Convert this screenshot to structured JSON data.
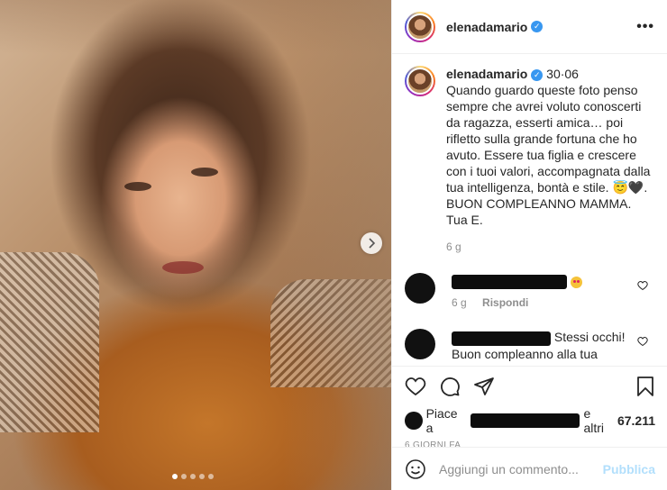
{
  "post": {
    "username": "elenadamario",
    "caption": {
      "username": "elenadamario",
      "date": "30·06",
      "text": "Quando guardo queste foto penso sempre che avrei voluto conoscerti da ragazza, esserti amica… poi rifletto sulla grande fortuna che ho avuto. Essere tua figlia e crescere con i tuoi valori, accompagnata dalla tua intelligenza, bontà e stile. 😇🖤.\nBUON COMPLEANNO MAMMA.\nTua E.",
      "age": "6 g"
    },
    "comments": [
      {
        "text": "",
        "age": "6 g",
        "reply_label": "Rispondi"
      },
      {
        "text": "Stessi occhi!\nBuon compleanno alla tua mamma"
      }
    ],
    "likes": {
      "prefix": "Piace a",
      "suffix": "e altri",
      "count": "67.211"
    },
    "date_label": "6 GIORNI FA",
    "add_comment": {
      "placeholder": "Aggiungi un commento...",
      "publish": "Pubblica"
    },
    "carousel": {
      "count": 5,
      "active": 1
    }
  },
  "colors": {
    "accent": "#3897f0",
    "muted": "#8e8e8e",
    "publish": "#b2dffc"
  }
}
